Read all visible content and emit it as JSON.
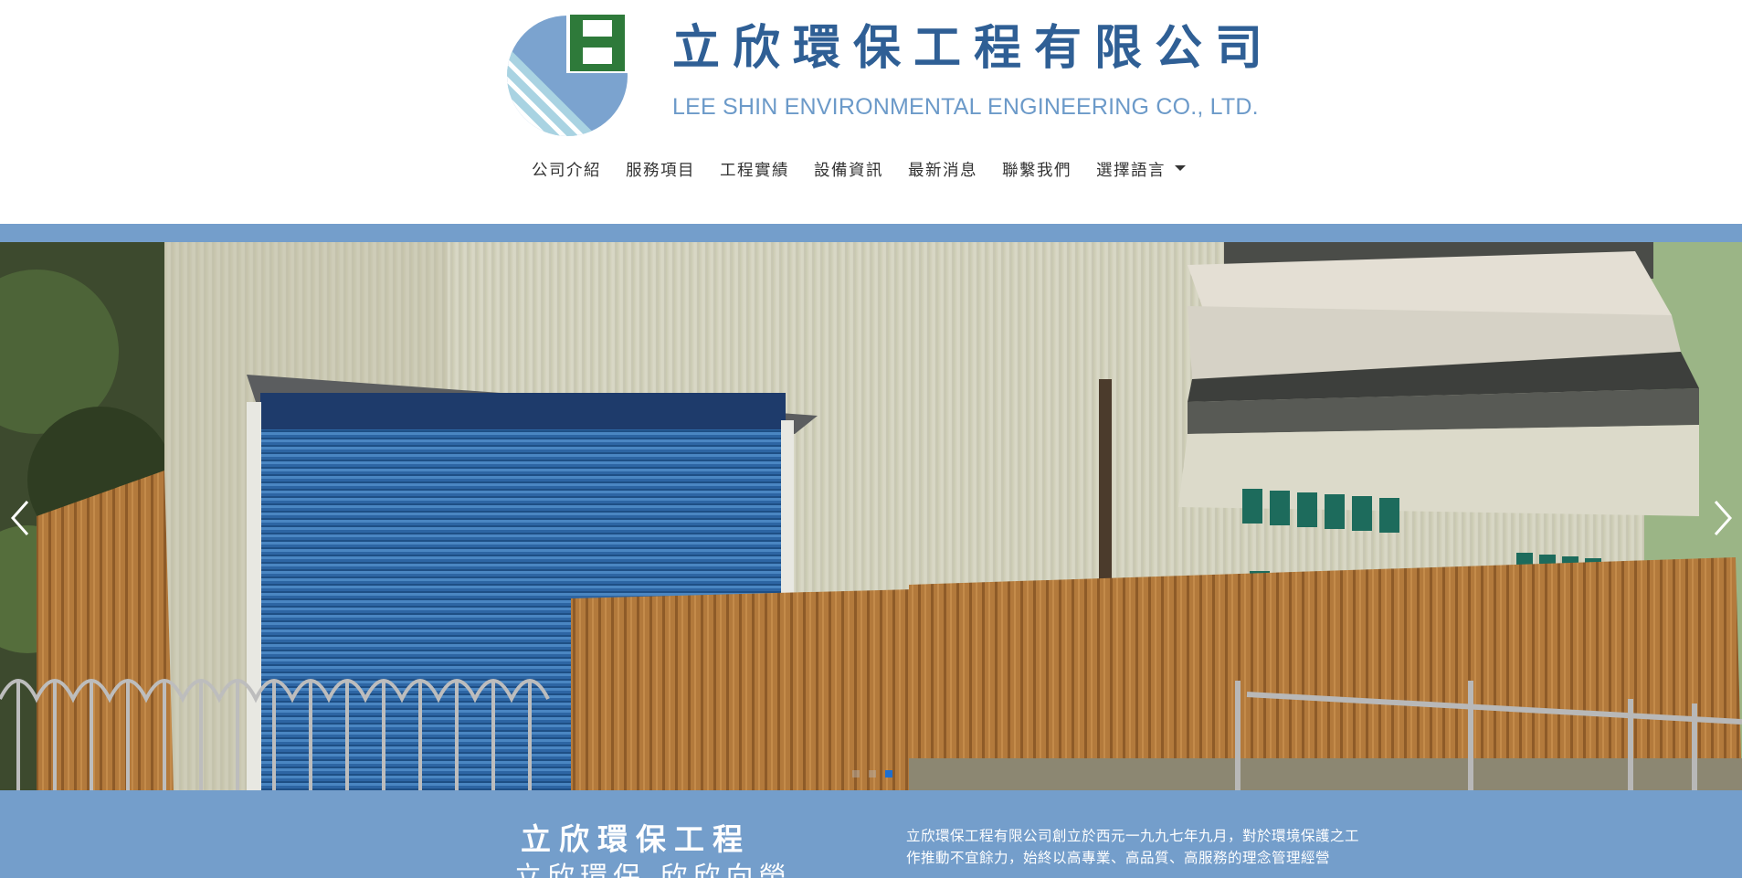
{
  "brand": {
    "name_cn": "立欣環保工程有限公司",
    "name_en": "LEE SHIN ENVIRONMENTAL ENGINEERING CO., LTD."
  },
  "nav": {
    "items": [
      {
        "label": "公司介紹"
      },
      {
        "label": "服務項目"
      },
      {
        "label": "工程實績"
      },
      {
        "label": "設備資訊"
      },
      {
        "label": "最新消息"
      },
      {
        "label": "聯繫我們"
      },
      {
        "label": "選擇語言"
      }
    ]
  },
  "carousel": {
    "slide_count": 3,
    "active_index": 2,
    "prev_icon": "chevron-left-icon",
    "next_icon": "chevron-right-icon"
  },
  "about": {
    "title": "立欣環保工程",
    "subtitle": "立欣環保 欣欣向榮",
    "text": "立欣環保工程有限公司創立於西元一九九七年九月，對於環境保護之工 作推動不宜餘力，始終以高專業、高品質、高服務的理念管理經營"
  },
  "colors": {
    "brand_blue": "#2f5f95",
    "brand_light_blue": "#6c9ac9",
    "band_blue": "#749ecb",
    "logo_green": "#2e7a3a",
    "active_dot": "#1e6fd0"
  }
}
